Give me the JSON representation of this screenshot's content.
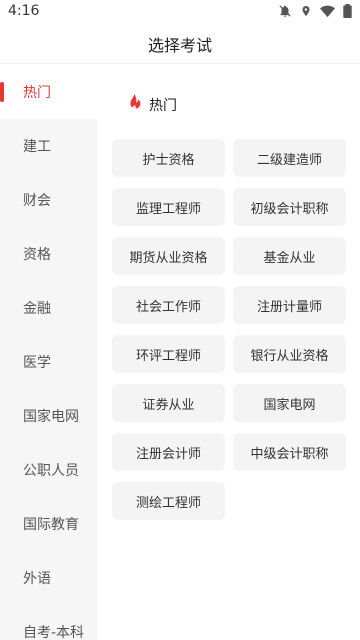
{
  "status_bar": {
    "time": "4:16",
    "icons": [
      "notifications-off-icon",
      "location-icon",
      "wifi-icon",
      "battery-icon"
    ]
  },
  "header": {
    "title": "选择考试"
  },
  "sidebar": {
    "items": [
      {
        "label": "热门",
        "active": true
      },
      {
        "label": "建工",
        "active": false
      },
      {
        "label": "财会",
        "active": false
      },
      {
        "label": "资格",
        "active": false
      },
      {
        "label": "金融",
        "active": false
      },
      {
        "label": "医学",
        "active": false
      },
      {
        "label": "国家电网",
        "active": false
      },
      {
        "label": "公职人员",
        "active": false
      },
      {
        "label": "国际教育",
        "active": false
      },
      {
        "label": "外语",
        "active": false
      },
      {
        "label": "自考-本科",
        "active": false
      }
    ]
  },
  "main": {
    "section": {
      "icon": "flame-icon",
      "title": "热门"
    },
    "exams": [
      "护士资格",
      "二级建造师",
      "监理工程师",
      "初级会计职称",
      "期货从业资格",
      "基金从业",
      "社会工作师",
      "注册计量师",
      "环评工程师",
      "银行从业资格",
      "证券从业",
      "国家电网",
      "注册会计师",
      "中级会计职称",
      "测绘工程师"
    ]
  },
  "colors": {
    "accent": "#e53935",
    "sidebar_bg": "#f6f6f6",
    "chip_bg": "#f4f4f4"
  }
}
